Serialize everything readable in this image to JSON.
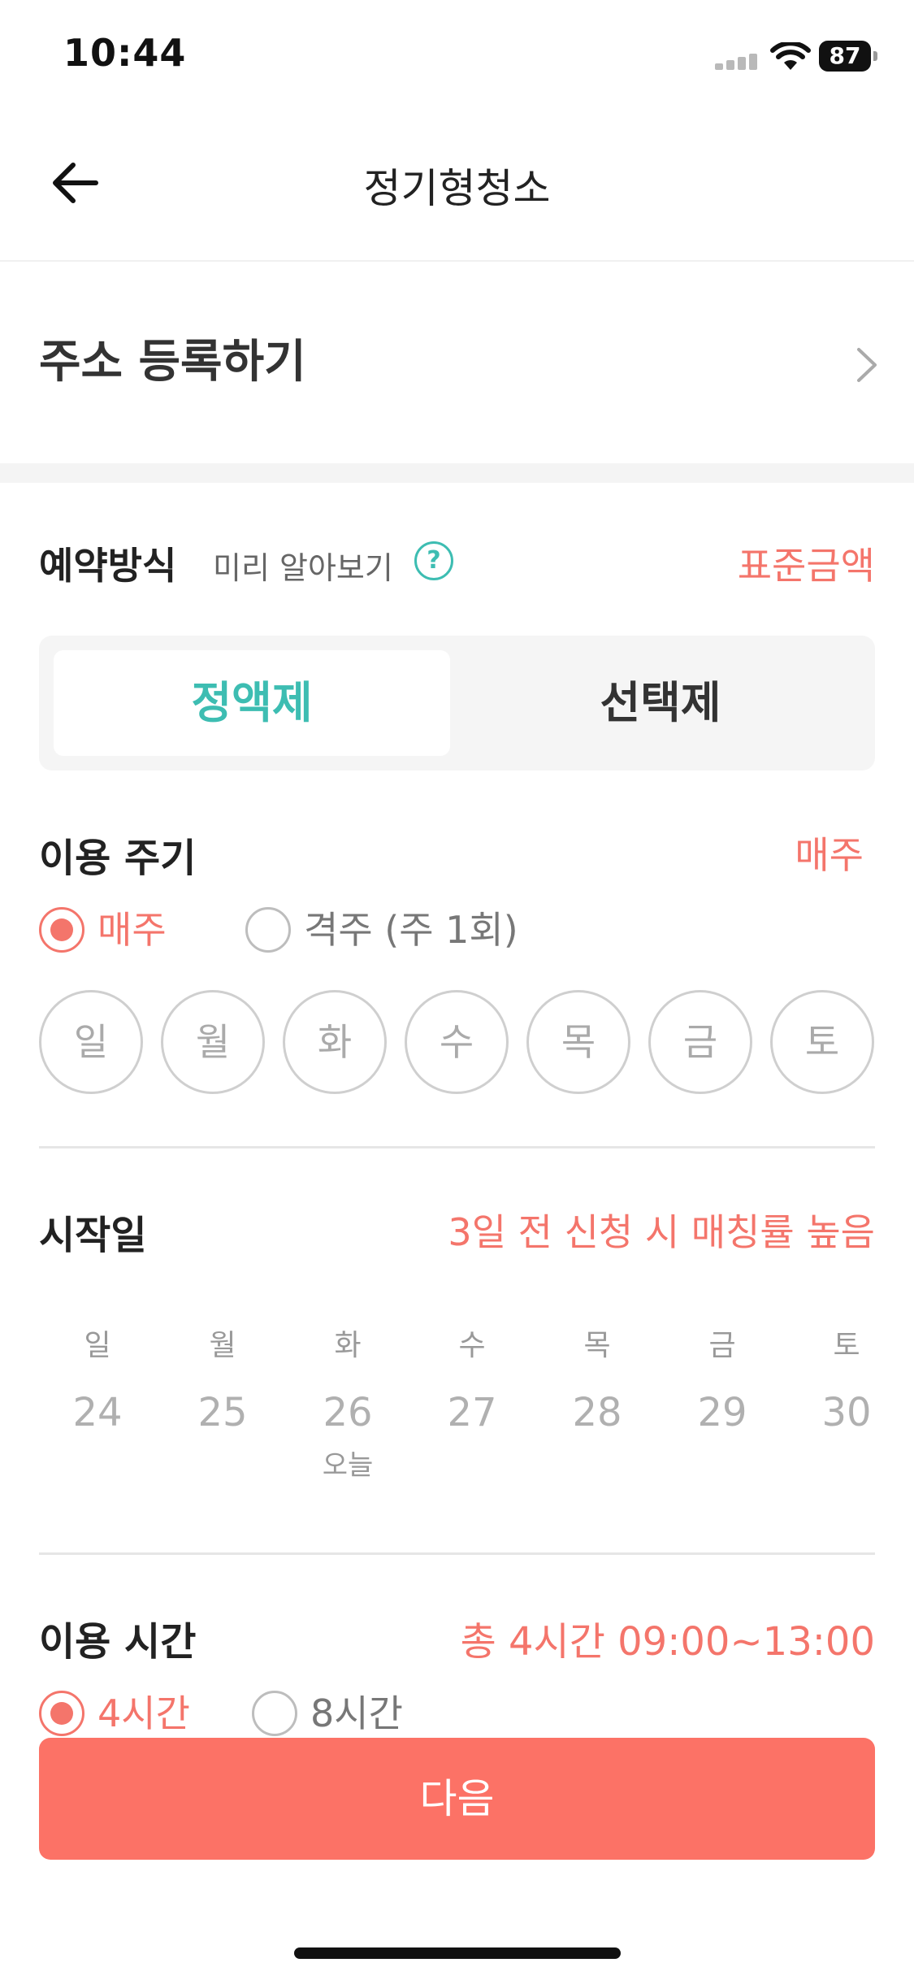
{
  "status_bar": {
    "time": "10:44",
    "battery": "87"
  },
  "header": {
    "title": "정기형청소"
  },
  "address": {
    "label": "주소 등록하기"
  },
  "reservation": {
    "title": "예약방식",
    "preview": "미리 알아보기",
    "help_symbol": "?",
    "standard_price": "표준금액",
    "tabs": [
      {
        "label": "정액제",
        "active": true
      },
      {
        "label": "선택제",
        "active": false
      }
    ]
  },
  "cycle": {
    "title": "이용 주기",
    "value": "매주",
    "options": [
      {
        "label": "매주",
        "selected": true
      },
      {
        "label": "격주 (주 1회)",
        "selected": false
      }
    ],
    "days": [
      "일",
      "월",
      "화",
      "수",
      "목",
      "금",
      "토"
    ]
  },
  "start_date": {
    "title": "시작일",
    "hint": "3일 전 신청 시 매칭률 높음",
    "weekdays": [
      "일",
      "월",
      "화",
      "수",
      "목",
      "금",
      "토"
    ],
    "dates": [
      "24",
      "25",
      "26",
      "27",
      "28",
      "29",
      "30"
    ],
    "today_label": "오늘"
  },
  "usage_time": {
    "title": "이용 시간",
    "value": "총 4시간 09:00~13:00",
    "options": [
      {
        "label": "4시간",
        "selected": true
      },
      {
        "label": "8시간",
        "selected": false
      }
    ]
  },
  "next_button": {
    "label": "다음"
  },
  "colors": {
    "accent": "#f4756b",
    "teal": "#3dbdb2",
    "button": "#fc7266"
  }
}
